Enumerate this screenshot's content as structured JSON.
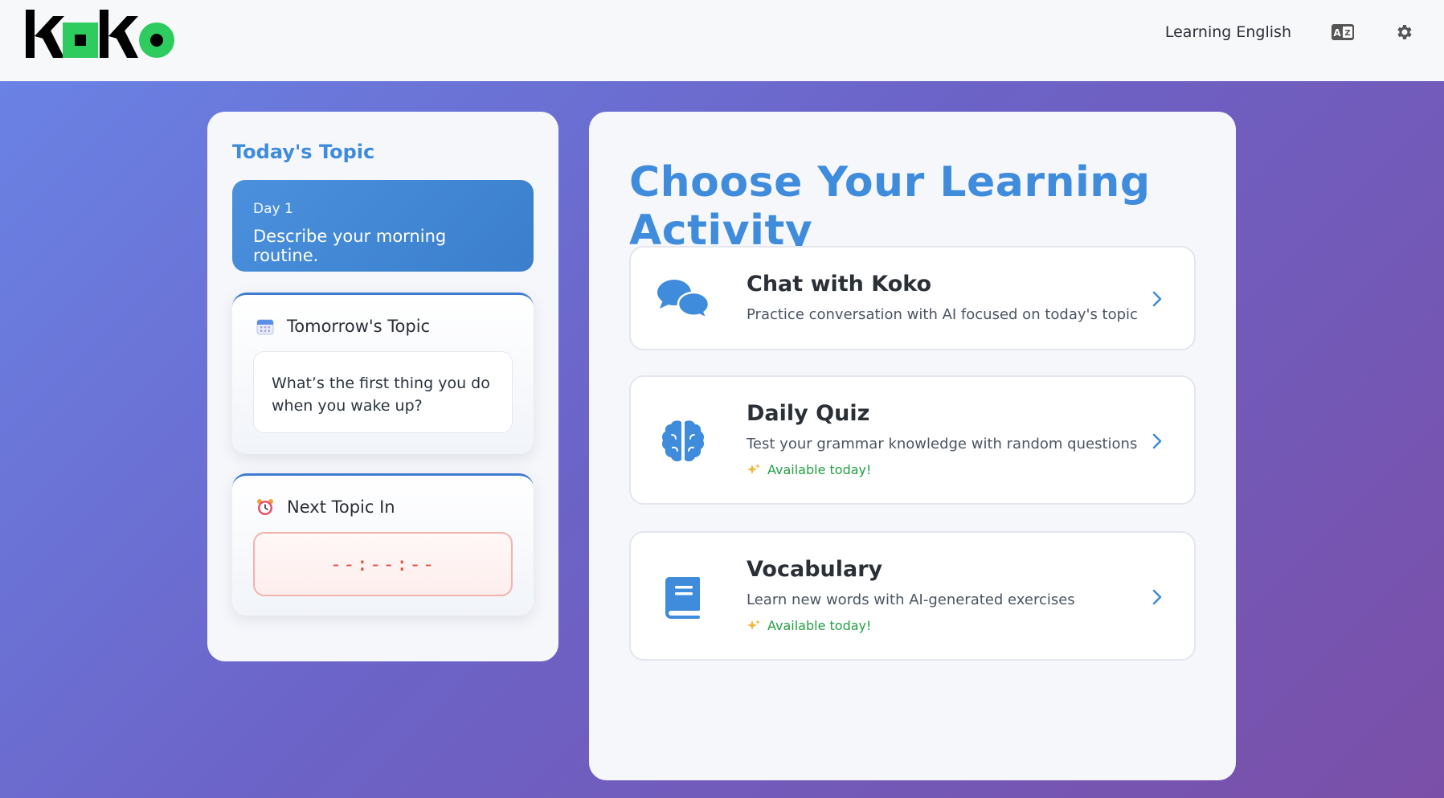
{
  "header": {
    "logo_text": "koko",
    "language_label": "Learning English",
    "icons": [
      "language-icon",
      "gear-icon"
    ]
  },
  "today": {
    "title": "Today's Topic",
    "day": "Day 1",
    "topic": "Describe your morning routine."
  },
  "tomorrow": {
    "title": "Tomorrow's Topic",
    "question": "What’s the first thing you do when you wake up?",
    "icon": "calendar-icon"
  },
  "next_topic": {
    "title": "Next Topic In",
    "countdown": "--:--:--",
    "icon": "alarm-clock-icon"
  },
  "activities_section": {
    "title": "Choose Your Learning Activity",
    "items": [
      {
        "title": "Chat with Koko",
        "description": "Practice conversation with AI focused on today's topic",
        "icon": "chat-bubbles-icon"
      },
      {
        "title": "Daily Quiz",
        "description": "Test your grammar knowledge with random questions",
        "availability": "Available today!",
        "icon": "brain-icon"
      },
      {
        "title": "Vocabulary",
        "description": "Learn new words with AI-generated exercises",
        "availability": "Available today!",
        "icon": "book-icon"
      }
    ]
  },
  "colors": {
    "accent": "#3f8bdc",
    "available_green": "#22a044",
    "countdown_red": "#e44b3f",
    "logo_green": "#2ecc5f"
  }
}
